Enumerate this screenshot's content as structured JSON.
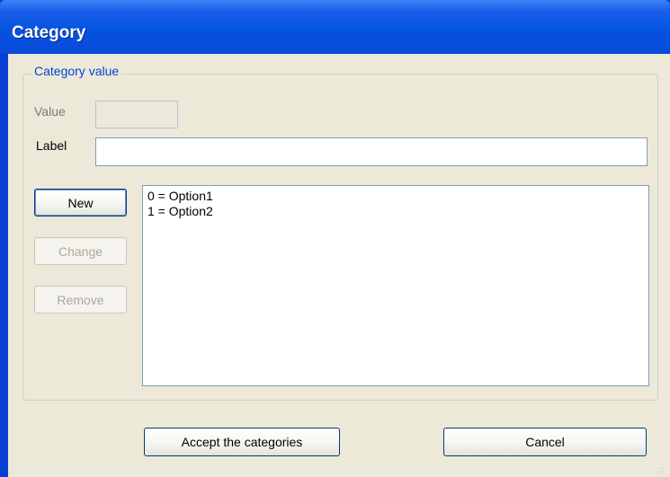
{
  "window": {
    "title": "Category"
  },
  "group": {
    "legend": "Category value"
  },
  "fields": {
    "value_label": "Value",
    "value_text": "",
    "label_label": "Label",
    "label_text": ""
  },
  "buttons": {
    "new": "New",
    "change": "Change",
    "remove": "Remove",
    "accept": "Accept the categories",
    "cancel": "Cancel"
  },
  "list": {
    "items": [
      "0 = Option1",
      "1 = Option2"
    ]
  },
  "colors": {
    "titlebar": "#0553e1",
    "client": "#ece9d8",
    "legend_text": "#0046d5"
  }
}
